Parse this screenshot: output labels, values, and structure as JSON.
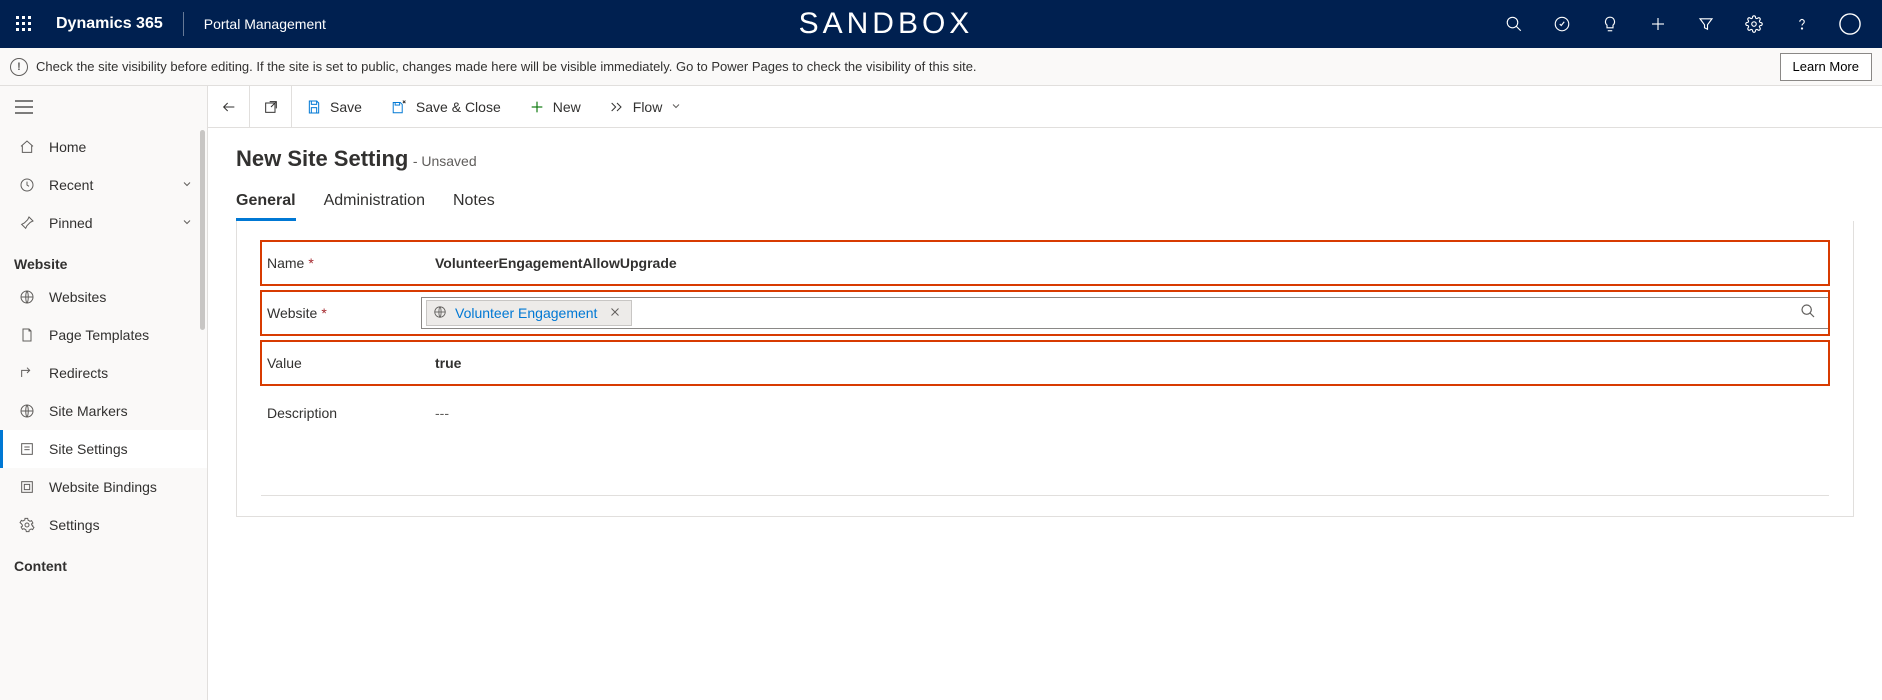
{
  "topbar": {
    "brand": "Dynamics 365",
    "app": "Portal Management",
    "env_label": "SANDBOX"
  },
  "notice": {
    "text": "Check the site visibility before editing. If the site is set to public, changes made here will be visible immediately. Go to Power Pages to check the visibility of this site.",
    "button": "Learn More"
  },
  "sidebar": {
    "home": "Home",
    "recent": "Recent",
    "pinned": "Pinned",
    "section_website": "Website",
    "websites": "Websites",
    "page_templates": "Page Templates",
    "redirects": "Redirects",
    "site_markers": "Site Markers",
    "site_settings": "Site Settings",
    "website_bindings": "Website Bindings",
    "settings": "Settings",
    "section_content": "Content"
  },
  "cmdbar": {
    "save": "Save",
    "save_close": "Save & Close",
    "new": "New",
    "flow": "Flow"
  },
  "form": {
    "title": "New Site Setting",
    "status": "- Unsaved",
    "tabs": {
      "general": "General",
      "administration": "Administration",
      "notes": "Notes"
    },
    "fields": {
      "name_label": "Name",
      "name_value": "VolunteerEngagementAllowUpgrade",
      "website_label": "Website",
      "website_value": "Volunteer Engagement",
      "value_label": "Value",
      "value_value": "true",
      "description_label": "Description",
      "description_value": "---"
    }
  }
}
